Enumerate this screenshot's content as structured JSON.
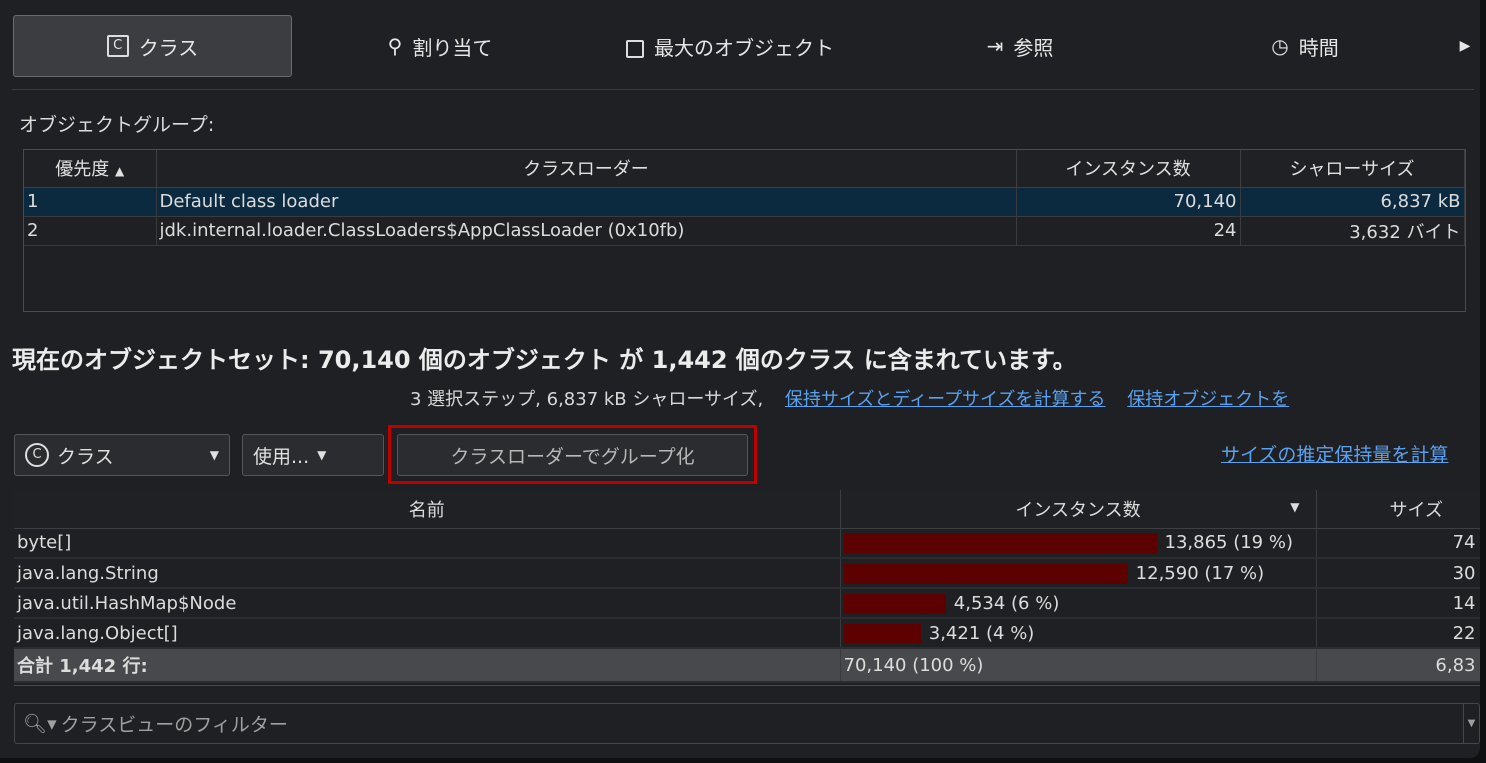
{
  "tabs": [
    {
      "label": "クラス",
      "icon": "class-icon"
    },
    {
      "label": "割り当て",
      "icon": "location-pin-icon"
    },
    {
      "label": "最大のオブジェクト",
      "icon": "bag-icon"
    },
    {
      "label": "参照",
      "icon": "reference-arrow-icon"
    },
    {
      "label": "時間",
      "icon": "clock-icon"
    }
  ],
  "groups": {
    "label": "オブジェクトグループ:",
    "columns": [
      "優先度",
      "クラスローダー",
      "インスタンス数",
      "シャローサイズ"
    ],
    "rows": [
      {
        "priority": "1",
        "loader": "Default class loader",
        "instances": "70,140",
        "size": "6,837 kB"
      },
      {
        "priority": "2",
        "loader": "jdk.internal.loader.ClassLoaders$AppClassLoader (0x10fb)",
        "instances": "24",
        "size": "3,632 バイト"
      }
    ]
  },
  "summary": {
    "heading": "現在のオブジェクトセット:  70,140 個のオブジェクト が 1,442 個のクラス に含まれています。",
    "sub": "3 選択ステップ, 6,837 kB シャローサイズ,",
    "link1": "保持サイズとディープサイズを計算する",
    "link2": "保持オブジェクトを"
  },
  "toolbar": {
    "view": "クラス",
    "use": "使用...",
    "group_by": "クラスローダーでグループ化",
    "estimate_link": "サイズの推定保持量を計算"
  },
  "classes": {
    "columns": [
      "名前",
      "インスタンス数",
      "サイズ"
    ],
    "rows": [
      {
        "name": "byte[]",
        "instances": "13,865 (19 %)",
        "pct": 19.77,
        "size": "74"
      },
      {
        "name": "java.lang.String",
        "instances": "12,590 (17 %)",
        "pct": 17.95,
        "size": "30"
      },
      {
        "name": "java.util.HashMap$Node",
        "instances": "4,534 (6 %)",
        "pct": 6.46,
        "size": "14"
      },
      {
        "name": "java.lang.Object[]",
        "instances": "3,421 (4 %)",
        "pct": 4.88,
        "size": "22"
      }
    ],
    "total": {
      "name": "合計 1,442 行:",
      "instances": "70,140 (100 %)",
      "size": "6,83"
    }
  },
  "filter": {
    "placeholder": "クラスビューのフィルター"
  },
  "colors": {
    "bar": "#5c0000",
    "link": "#5aa1ef",
    "highlight": "#c00000",
    "selected": "#0b2a40"
  }
}
